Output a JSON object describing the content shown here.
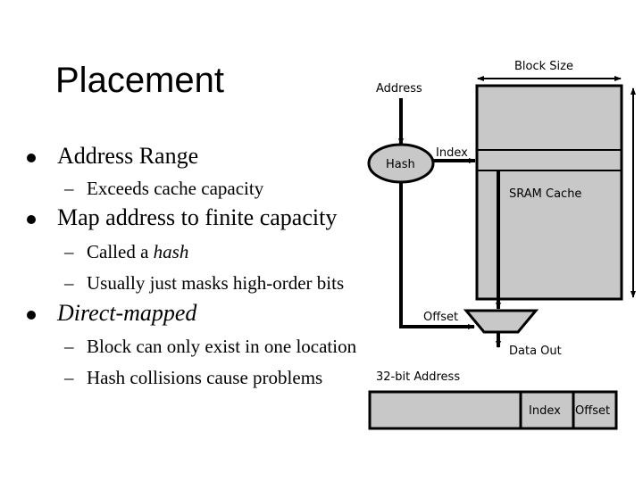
{
  "slide": {
    "title": "Placement",
    "bullets": [
      {
        "text": "Address Range",
        "italic": false,
        "sub": [
          {
            "text": "Exceeds cache capacity"
          }
        ]
      },
      {
        "text": "Map address to finite capacity",
        "italic": false,
        "sub": [
          {
            "text_prefix": "Called a ",
            "text_italic": "hash"
          },
          {
            "text": "Usually just masks high-order bits"
          }
        ]
      },
      {
        "text": "Direct-mapped",
        "italic": true,
        "sub": [
          {
            "text": "Block can only exist in one location"
          },
          {
            "text": "Hash collisions cause problems"
          }
        ]
      }
    ],
    "dash_glyph": "–"
  },
  "diagram": {
    "address_label": "Address",
    "hash_label": "Hash",
    "index_label": "Index",
    "block_size_label": "Block Size",
    "cache_label": "SRAM Cache",
    "offset_label": "Offset",
    "data_out_label": "Data Out",
    "address_bits_label": "32-bit Address",
    "address_fields": [
      "",
      "Index",
      "Offset"
    ],
    "colors": {
      "fill": "#c8c8c8",
      "stroke": "#000000"
    }
  }
}
